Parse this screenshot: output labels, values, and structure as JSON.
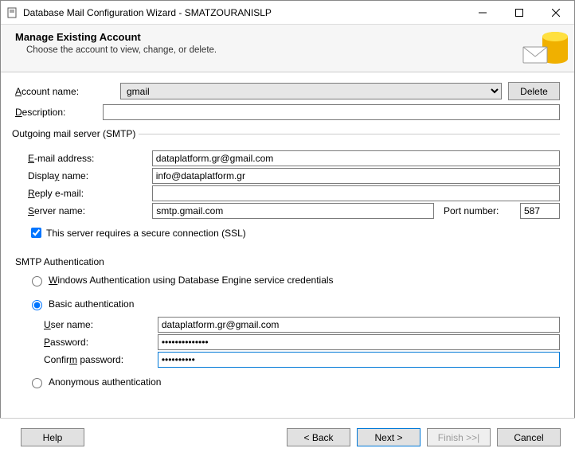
{
  "window": {
    "title": "Database Mail Configuration Wizard - SMATZOURANISLP"
  },
  "header": {
    "title": "Manage Existing Account",
    "subtitle": "Choose the account to view, change, or delete."
  },
  "account": {
    "name_label": "Account name:",
    "name_value": "gmail",
    "delete_label": "Delete",
    "desc_label": "Description:",
    "desc_value": ""
  },
  "smtp": {
    "legend": "Outgoing mail server (SMTP)",
    "email_label": "E-mail address:",
    "email_value": "dataplatform.gr@gmail.com",
    "display_label": "Display name:",
    "display_value": "info@dataplatform.gr",
    "reply_label": "Reply e-mail:",
    "reply_value": "",
    "server_label": "Server name:",
    "server_value": "smtp.gmail.com",
    "port_label": "Port number:",
    "port_value": "587",
    "ssl_label": "This server requires a secure connection (SSL)"
  },
  "auth": {
    "section": "SMTP Authentication",
    "windows_label": "Windows Authentication using Database Engine service credentials",
    "basic_label": "Basic authentication",
    "anon_label": "Anonymous authentication",
    "user_label": "User name:",
    "user_value": "dataplatform.gr@gmail.com",
    "pass_label": "Password:",
    "pass_value": "••••••••••••••",
    "confirm_label": "Confirm password:",
    "confirm_value": "••••••••••"
  },
  "footer": {
    "help": "Help",
    "back": "< Back",
    "next": "Next >",
    "finish": "Finish >>|",
    "cancel": "Cancel"
  }
}
